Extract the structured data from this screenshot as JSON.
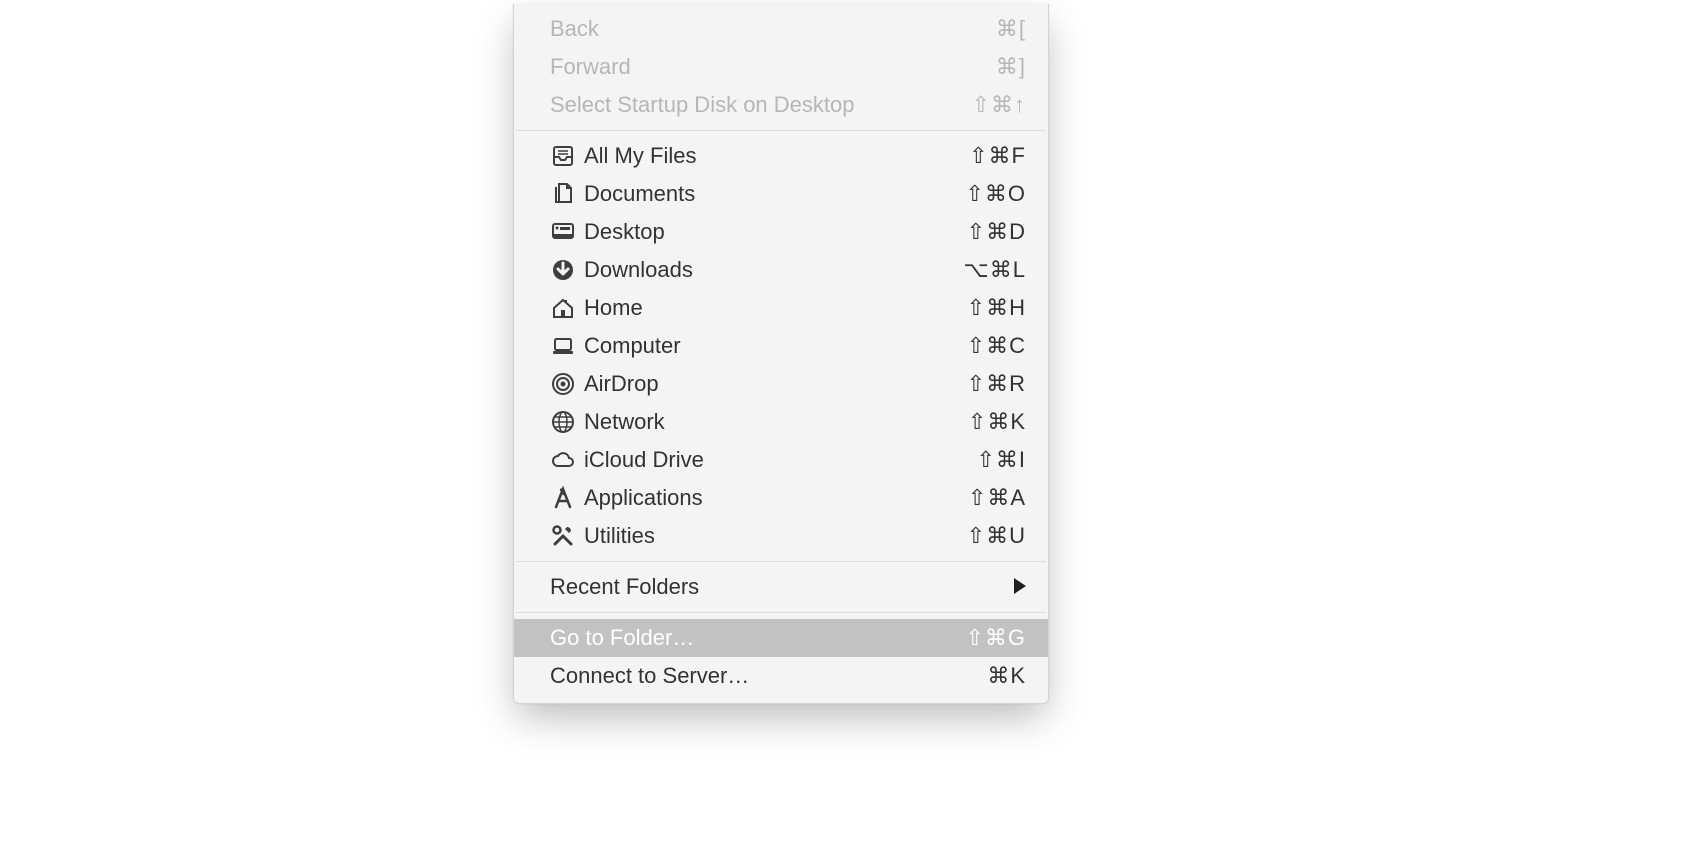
{
  "menu": {
    "section1": [
      {
        "id": "back",
        "label": "Back",
        "shortcut": "⌘[",
        "disabled": true
      },
      {
        "id": "forward",
        "label": "Forward",
        "shortcut": "⌘]",
        "disabled": true
      },
      {
        "id": "startup",
        "label": "Select Startup Disk on Desktop",
        "shortcut": "⇧⌘↑",
        "disabled": true
      }
    ],
    "section2": [
      {
        "id": "allmyfiles",
        "label": "All My Files",
        "shortcut": "⇧⌘F",
        "icon": "tray"
      },
      {
        "id": "documents",
        "label": "Documents",
        "shortcut": "⇧⌘O",
        "icon": "docs"
      },
      {
        "id": "desktop",
        "label": "Desktop",
        "shortcut": "⇧⌘D",
        "icon": "desktop"
      },
      {
        "id": "downloads",
        "label": "Downloads",
        "shortcut": "⌥⌘L",
        "icon": "download"
      },
      {
        "id": "home",
        "label": "Home",
        "shortcut": "⇧⌘H",
        "icon": "home"
      },
      {
        "id": "computer",
        "label": "Computer",
        "shortcut": "⇧⌘C",
        "icon": "laptop"
      },
      {
        "id": "airdrop",
        "label": "AirDrop",
        "shortcut": "⇧⌘R",
        "icon": "airdrop"
      },
      {
        "id": "network",
        "label": "Network",
        "shortcut": "⇧⌘K",
        "icon": "globe"
      },
      {
        "id": "icloud",
        "label": "iCloud Drive",
        "shortcut": "⇧⌘I",
        "icon": "cloud"
      },
      {
        "id": "applications",
        "label": "Applications",
        "shortcut": "⇧⌘A",
        "icon": "apps"
      },
      {
        "id": "utilities",
        "label": "Utilities",
        "shortcut": "⇧⌘U",
        "icon": "tools"
      }
    ],
    "section3": [
      {
        "id": "recent",
        "label": "Recent Folders",
        "submenu": true
      }
    ],
    "section4": [
      {
        "id": "gotofolder",
        "label": "Go to Folder…",
        "shortcut": "⇧⌘G",
        "highlight": true
      },
      {
        "id": "connect",
        "label": "Connect to Server…",
        "shortcut": "⌘K"
      }
    ]
  }
}
